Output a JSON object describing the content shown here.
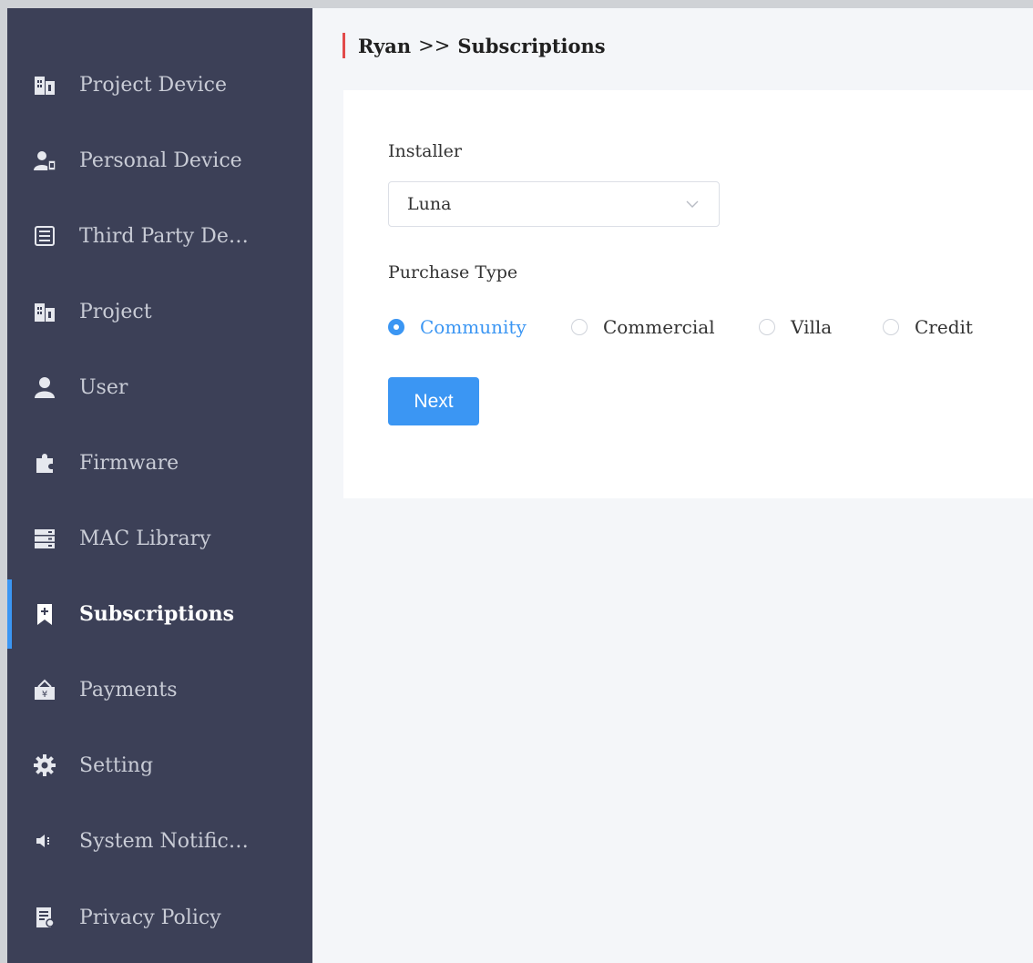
{
  "sidebar": {
    "items": [
      {
        "label": "Project Device",
        "icon": "building-icon"
      },
      {
        "label": "Personal Device",
        "icon": "user-device-icon"
      },
      {
        "label": "Third Party De…",
        "icon": "list-icon"
      },
      {
        "label": "Project",
        "icon": "building-icon"
      },
      {
        "label": "User",
        "icon": "user-icon"
      },
      {
        "label": "Firmware",
        "icon": "puzzle-icon"
      },
      {
        "label": "MAC Library",
        "icon": "server-icon"
      },
      {
        "label": "Subscriptions",
        "icon": "bookmark-plus-icon",
        "active": true
      },
      {
        "label": "Payments",
        "icon": "bag-yen-icon"
      },
      {
        "label": "Setting",
        "icon": "gear-icon"
      },
      {
        "label": "System Notific…",
        "icon": "speaker-icon"
      },
      {
        "label": "Privacy Policy",
        "icon": "document-icon"
      }
    ]
  },
  "breadcrumb": {
    "parent": "Ryan",
    "separator": ">>",
    "current": "Subscriptions"
  },
  "form": {
    "installer_label": "Installer",
    "installer_value": "Luna",
    "purchase_type_label": "Purchase Type",
    "options": [
      {
        "label": "Community",
        "checked": true
      },
      {
        "label": "Commercial",
        "checked": false
      },
      {
        "label": "Villa",
        "checked": false
      },
      {
        "label": "Credit",
        "checked": false
      }
    ],
    "next_label": "Next"
  },
  "colors": {
    "sidebar_bg": "#3c4057",
    "accent": "#3b96f3",
    "crumb_bar": "#e24b4b"
  }
}
